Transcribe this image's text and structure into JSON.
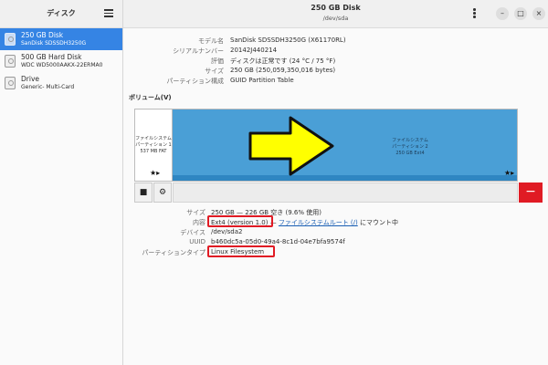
{
  "sidebar": {
    "title": "ディスク",
    "disks": [
      {
        "name": "250 GB Disk",
        "model": "SanDisk SDSSDH3250G"
      },
      {
        "name": "500 GB Hard Disk",
        "model": "WDC WD5000AAKX-22ERMA0"
      },
      {
        "name": "Drive",
        "model": "Generic- Multi-Card"
      }
    ]
  },
  "header": {
    "title": "250 GB Disk",
    "subtitle": "/dev/sda"
  },
  "window_controls": {
    "minimize": "–",
    "maximize": "□",
    "close": "×"
  },
  "disk_info": [
    {
      "label": "モデル名",
      "value": "SanDisk SDSSDH3250G (X61170RL)"
    },
    {
      "label": "シリアルナンバー",
      "value": "20142J440214"
    },
    {
      "label": "評価",
      "value": "ディスクは正常です (24 °C / 75 °F)"
    },
    {
      "label": "サイズ",
      "value": "250 GB (250,059,350,016 bytes)"
    },
    {
      "label": "パーティション構成",
      "value": "GUID Partition Table"
    }
  ],
  "volumes_title": "ボリューム(V)",
  "partitions": [
    {
      "line1": "ファイルシステム",
      "line2": "パーティション 1",
      "line3": "537 MB FAT"
    },
    {
      "line1": "ファイルシステム",
      "line2": "パーティション 2",
      "line3": "250 GB Ext4"
    }
  ],
  "volume_toolbar": {
    "stop": "■",
    "settings": "⚙",
    "remove": "−"
  },
  "details": {
    "size_label": "サイズ",
    "size_value": "250 GB — 226 GB 空き (9.6% 使用)",
    "contents_label": "内容",
    "contents_value": "Ext4 (version 1.0)",
    "contents_sep": " — ",
    "contents_link": "ファイルシステムルート (/)",
    "contents_suffix": " にマウント中",
    "device_label": "デバイス",
    "device_value": "/dev/sda2",
    "uuid_label": "UUID",
    "uuid_value": "b460dc5a-05d0-49a4-8c1d-04e7bfa9574f",
    "ptype_label": "パーティションタイプ",
    "ptype_value": "Linux Filesystem"
  },
  "colors": {
    "accent": "#3584e4",
    "partition": "#4a9fd6",
    "highlight": "#e01b24",
    "arrow": "#ffff00"
  }
}
